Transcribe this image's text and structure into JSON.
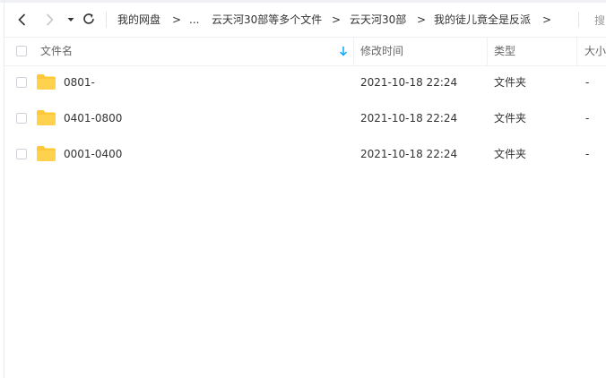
{
  "breadcrumb": {
    "items": [
      "我的网盘",
      "...",
      "云天河30部等多个文件",
      "云天河30部",
      "我的徒儿竟全是反派"
    ],
    "separator": ">"
  },
  "search": {
    "label": "搜"
  },
  "table": {
    "columns": {
      "name": "文件名",
      "modified": "修改时间",
      "type": "类型",
      "size": "大小"
    },
    "sort_icon": "arrow-down-icon",
    "rows": [
      {
        "name": "0801-",
        "modified": "2021-10-18 22:24",
        "type": "文件夹",
        "size": "-"
      },
      {
        "name": "0401-0800",
        "modified": "2021-10-18 22:24",
        "type": "文件夹",
        "size": "-"
      },
      {
        "name": "0001-0400",
        "modified": "2021-10-18 22:24",
        "type": "文件夹",
        "size": "-"
      }
    ]
  },
  "colors": {
    "accent": "#06a7ff",
    "folder": "#ffd24d",
    "folder_tab": "#ffc83a"
  }
}
